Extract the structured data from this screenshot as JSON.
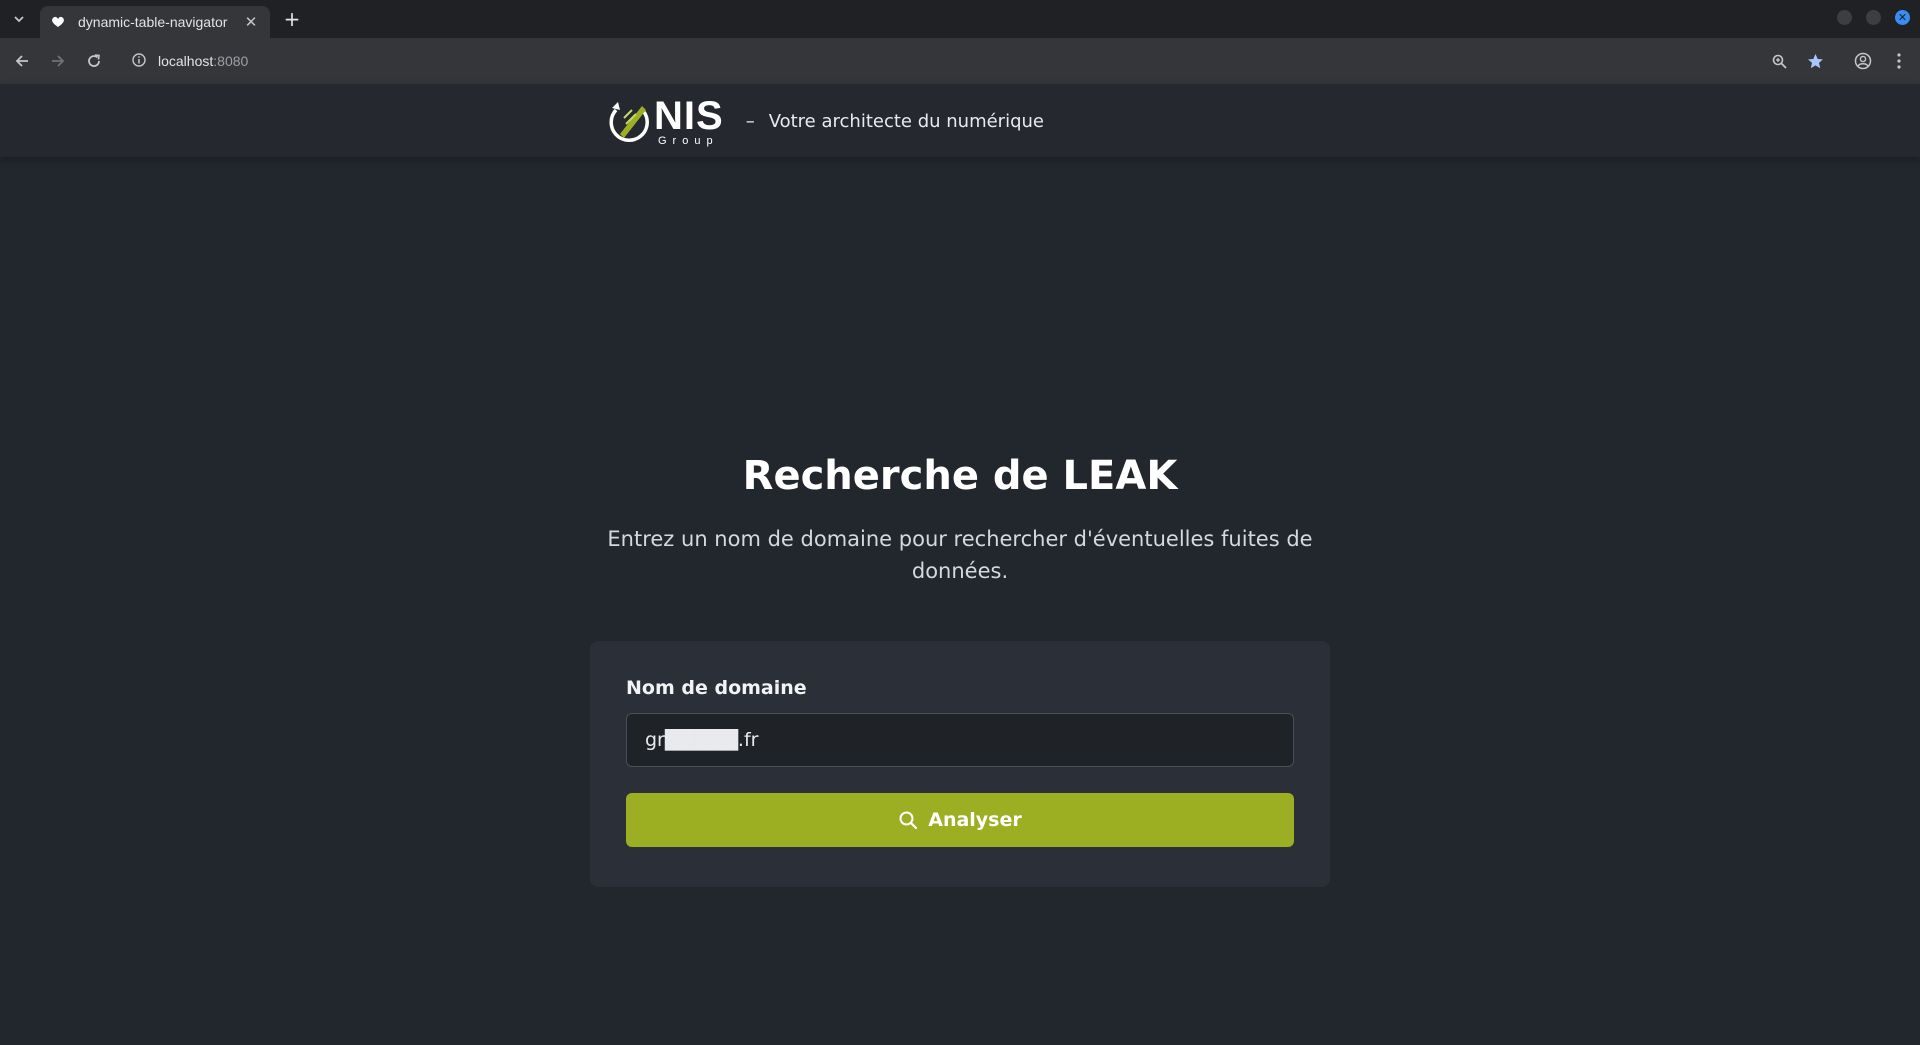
{
  "browser": {
    "tab_title": "dynamic-table-navigator",
    "url_host": "localhost",
    "url_port": ":8080",
    "icons": [
      "tab-search-icon",
      "favicon-heart-icon",
      "close-icon",
      "new-tab-icon",
      "back-icon",
      "forward-icon",
      "reload-icon",
      "site-info-icon",
      "zoom-icon",
      "bookmark-star-icon",
      "profile-icon",
      "menu-icon"
    ]
  },
  "header": {
    "logo_main": "NIS",
    "logo_sub": "Group",
    "separator": "–",
    "tagline": "Votre architecte du numérique"
  },
  "main": {
    "title": "Recherche de LEAK",
    "description": "Entrez un nom de domaine pour rechercher d'éventuelles fuites de données.",
    "form": {
      "label": "Nom de domaine",
      "input_value": "gr█████.fr",
      "button_label": "Analyser",
      "button_icon": "search-icon"
    }
  },
  "colors": {
    "accent": "#9caf23",
    "background": "#22262d",
    "card": "#2b3038"
  }
}
